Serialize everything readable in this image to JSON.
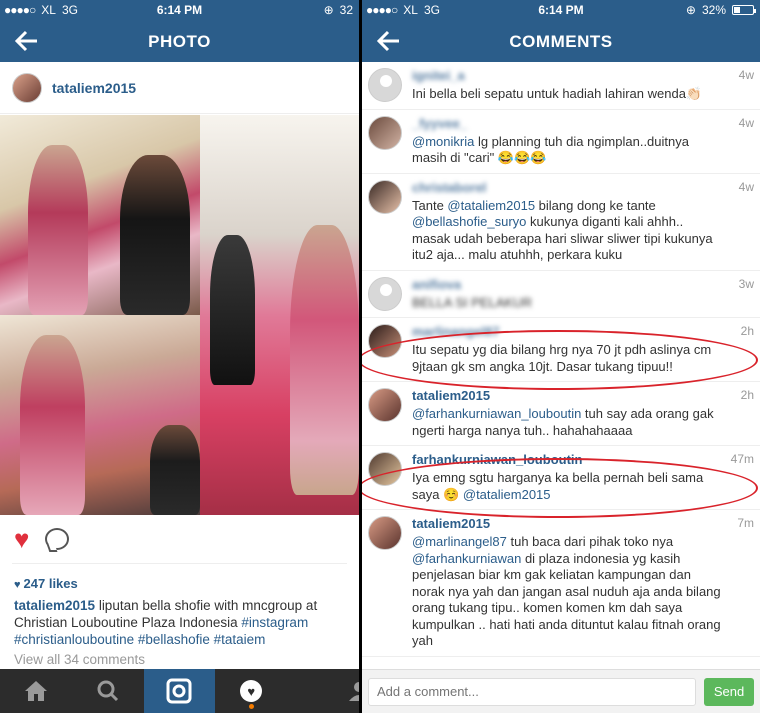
{
  "left": {
    "status": {
      "carrier": "XL",
      "network": "3G",
      "time": "6:14 PM",
      "battery": "32"
    },
    "nav_title": "PHOTO",
    "post": {
      "username": "tataliem2015",
      "likes": "247 likes",
      "caption_user": "tataliem2015",
      "caption_text": " liputan bella shofie with mncgroup at Christian Louboutine Plaza Indonesia ",
      "caption_tags": "#instagram #christianlouboutine #bellashofie #tataiem",
      "view_all": "View all 34 comments"
    },
    "tabs": [
      "home-icon",
      "search-icon",
      "camera-icon",
      "activity-icon",
      "profile-icon"
    ]
  },
  "right": {
    "status": {
      "carrier": "XL",
      "network": "3G",
      "time": "6:14 PM",
      "battery": "32%"
    },
    "nav_title": "COMMENTS",
    "comments": [
      {
        "user": "ignitei_a",
        "blurred_user": true,
        "time": "4w",
        "text": "Ini bella beli sepatu untuk hadiah lahiran wenda👏🏻",
        "blurred_text": false
      },
      {
        "user": "_fyyvee_",
        "blurred_user": true,
        "time": "4w",
        "text_parts": [
          {
            "mention": "@monikria"
          },
          {
            "text": " lg planning tuh dia ngimplan..duitnya masih di \"cari\" 😂😂😂"
          }
        ]
      },
      {
        "user": "christaborel",
        "blurred_user": true,
        "time": "4w",
        "text_parts": [
          {
            "text": "Tante "
          },
          {
            "mention": "@tataliem2015"
          },
          {
            "text": " bilang dong ke tante "
          },
          {
            "mention": "@bellashofie_suryo"
          },
          {
            "text": " kukunya diganti kali ahhh.. masak udah beberapa hari sliwar sliwer tipi kukunya itu2 aja... malu atuhhh, perkara kuku"
          }
        ]
      },
      {
        "user": "anifiova",
        "blurred_user": true,
        "time": "3w",
        "text": "BELLA SI PELAKUR",
        "blurred_text": true
      },
      {
        "user": "marlinangel87",
        "blurred_user": true,
        "time": "2h",
        "text": "Itu sepatu yg dia bilang hrg nya 70 jt pdh aslinya cm 9jtaan gk sm angka 10jt. Dasar tukang tipuu!!",
        "blurred_text": false
      },
      {
        "user": "tataliem2015",
        "blurred_user": false,
        "time": "2h",
        "text_parts": [
          {
            "mention": "@farhankurniawan_louboutin"
          },
          {
            "text": " tuh say ada orang gak ngerti harga nanya tuh.. hahahahaaaa"
          }
        ]
      },
      {
        "user": "farhankurniawan_louboutin",
        "blurred_user": false,
        "time": "47m",
        "text_parts": [
          {
            "text": "Iya emng sgtu harganya ka bella pernah beli sama saya ☺️ "
          },
          {
            "mention": "@tataliem2015"
          }
        ]
      },
      {
        "user": "tataliem2015",
        "blurred_user": false,
        "time": "7m",
        "text_parts": [
          {
            "mention": "@marlinangel87"
          },
          {
            "text": " tuh baca dari pihak toko nya "
          },
          {
            "mention": "@farhankurniawan"
          },
          {
            "text": " di plaza indonesia yg kasih penjelasan biar km gak keliatan kampungan dan norak nya yah dan jangan asal nuduh aja anda bilang orang tukang tipu.. komen komen km dah saya kumpulkan .. hati hati anda dituntut kalau fitnah orang yah"
          }
        ]
      }
    ],
    "input_placeholder": "Add a comment...",
    "send_label": "Send",
    "accent_color": "#2b5d8a",
    "highlight_color": "#d9232b"
  }
}
